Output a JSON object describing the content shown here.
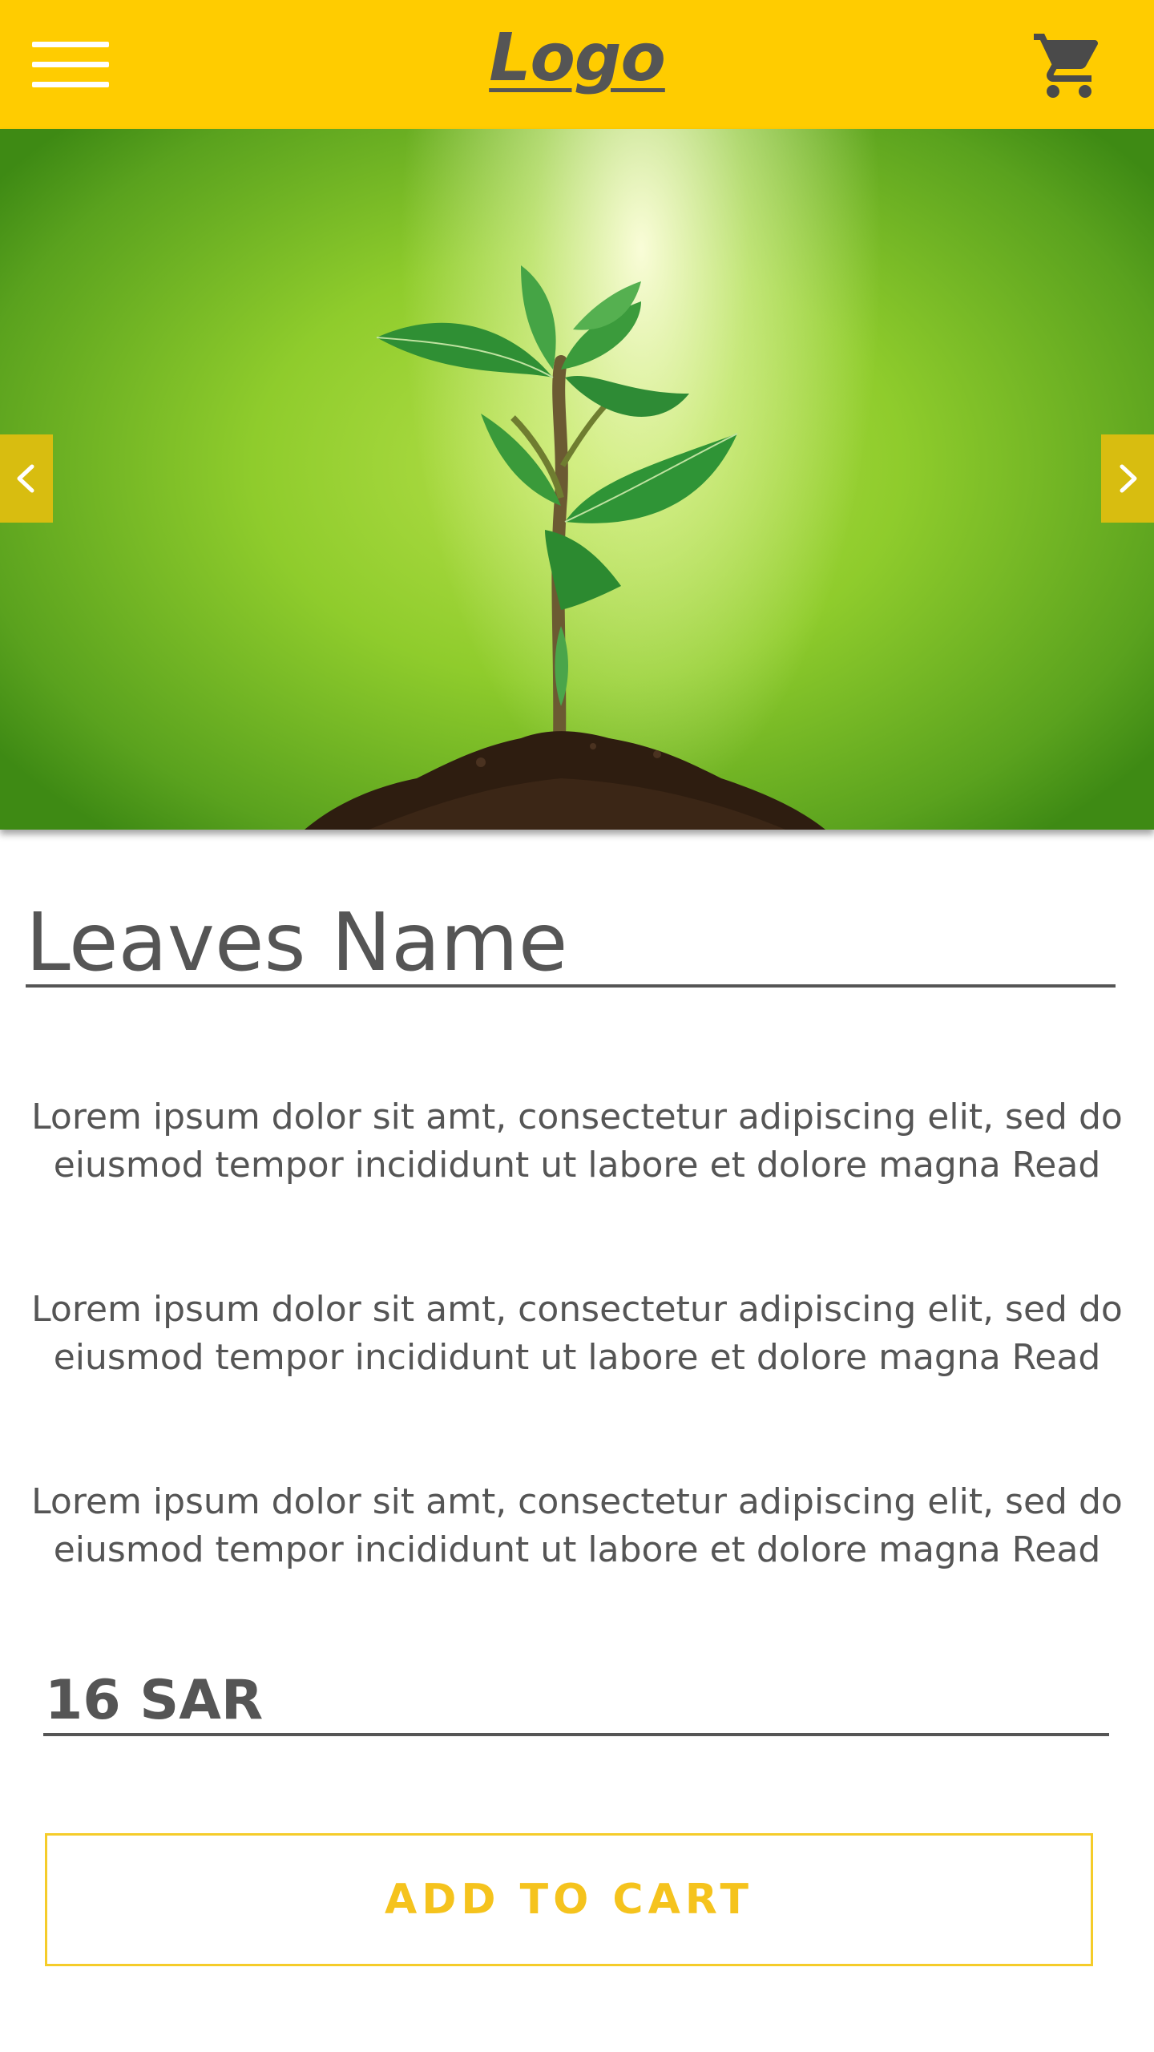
{
  "header": {
    "logo_text": "Logo",
    "menu_icon": "hamburger-menu-icon",
    "cart_icon": "shopping-cart-icon",
    "background_color": "#ffcc00"
  },
  "hero": {
    "image": "seedling-sprout-in-soil",
    "prev_icon": "chevron-left-icon",
    "next_icon": "chevron-right-icon",
    "arrow_color": "#d8bd10"
  },
  "product": {
    "title": "Leaves Name",
    "descriptions": [
      "Lorem ipsum dolor sit amt, consectetur adipiscing elit, sed do eiusmod tempor incididunt ut labore et dolore magna Read",
      "Lorem ipsum dolor sit amt, consectetur adipiscing elit, sed do eiusmod tempor incididunt ut labore et dolore magna Read",
      "Lorem ipsum dolor sit amt, consectetur adipiscing elit, sed do eiusmod tempor incididunt ut labore et dolore magna Read"
    ],
    "price": "16 SAR",
    "add_to_cart_label": "ADD TO CART",
    "accent_color": "#f5c31d",
    "text_color": "#555555"
  }
}
